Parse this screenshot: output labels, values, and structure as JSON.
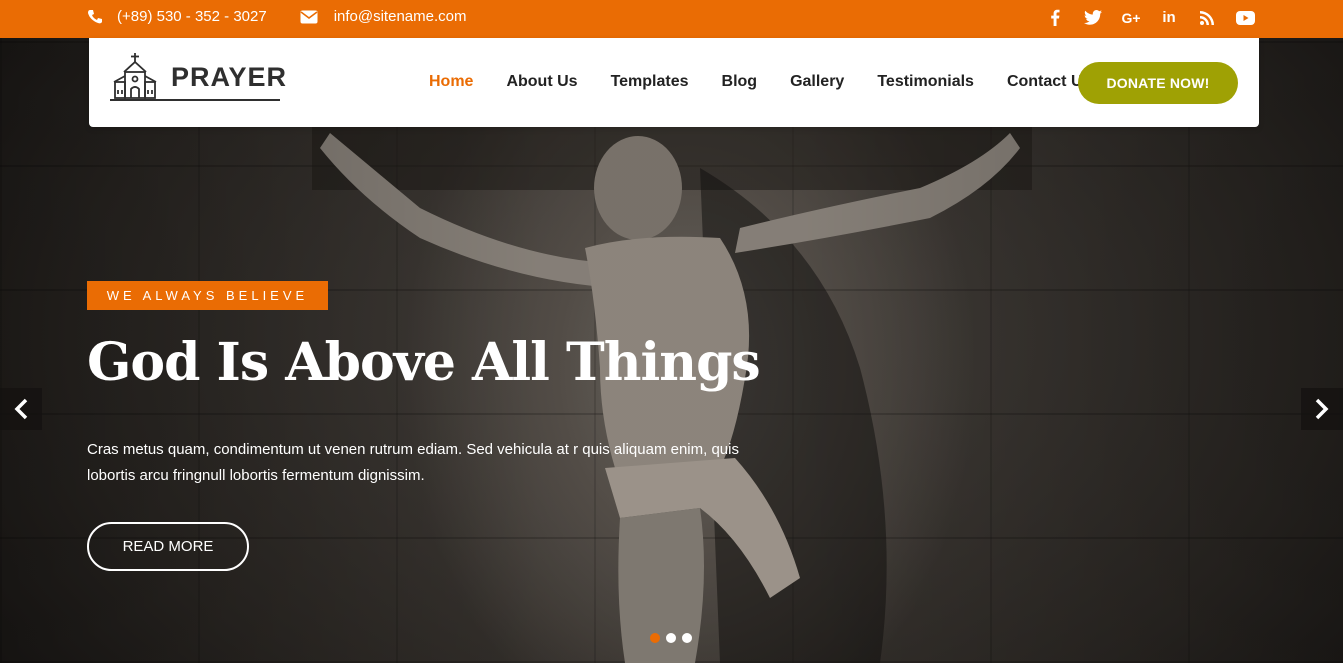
{
  "topbar": {
    "phone": "(+89) 530 - 352 - 3027",
    "email": "info@sitename.com",
    "social": [
      "f",
      "t",
      "G+",
      "in",
      "rss",
      "yt"
    ]
  },
  "brand": {
    "name": "PRAYER"
  },
  "nav": {
    "items": [
      {
        "label": "Home"
      },
      {
        "label": "About Us"
      },
      {
        "label": "Templates"
      },
      {
        "label": "Blog"
      },
      {
        "label": "Gallery"
      },
      {
        "label": "Testimonials"
      },
      {
        "label": "Contact Us"
      }
    ],
    "donate_label": "DONATE NOW!"
  },
  "slide": {
    "tag": "WE ALWAYS BELIEVE",
    "title": "God Is Above All Things",
    "description": "Cras metus quam, condimentum ut venen rutrum ediam. Sed vehicula at r quis aliquam enim, quis lobortis arcu fringnull lobortis fermentum dignissim.",
    "button": "READ MORE"
  },
  "colors": {
    "accent": "#ea6c04",
    "donate": "#9fa104"
  },
  "slider": {
    "dots": 3,
    "active": 0
  }
}
